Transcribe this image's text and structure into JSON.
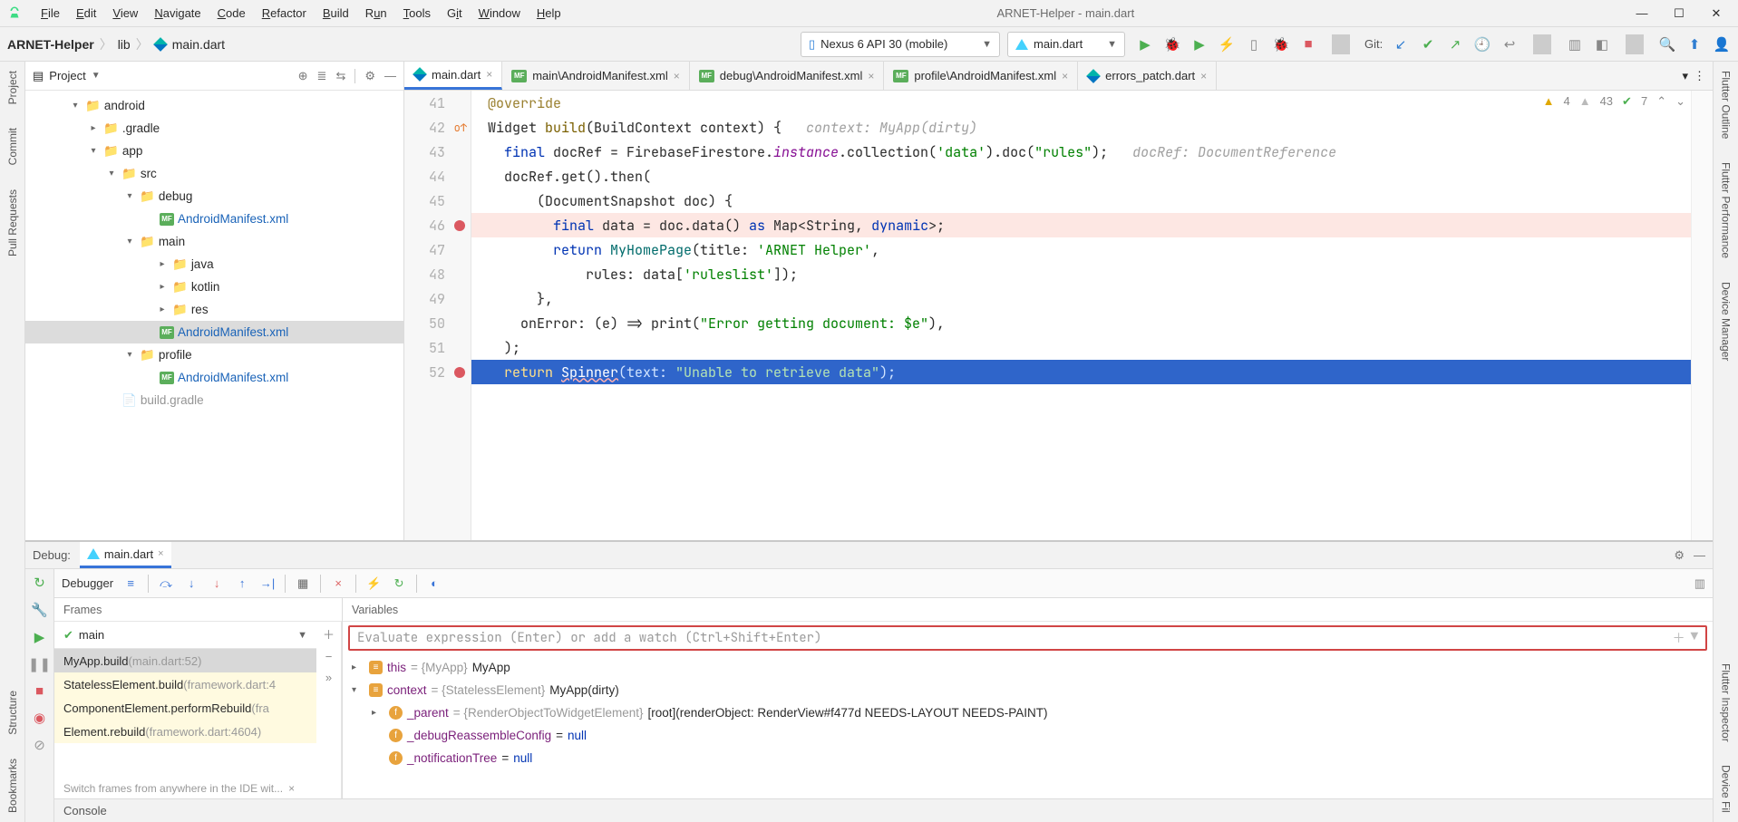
{
  "window_title": "ARNET-Helper - main.dart",
  "menu": [
    "File",
    "Edit",
    "View",
    "Navigate",
    "Code",
    "Refactor",
    "Build",
    "Run",
    "Tools",
    "Git",
    "Window",
    "Help"
  ],
  "breadcrumb": {
    "project": "ARNET-Helper",
    "folder": "lib",
    "file": "main.dart"
  },
  "device_dropdown": "Nexus 6 API 30 (mobile)",
  "config_dropdown": "main.dart",
  "git_label": "Git:",
  "project_panel_title": "Project",
  "tree": {
    "root": "android",
    "gradle": ".gradle",
    "app": "app",
    "src": "src",
    "debug": "debug",
    "debug_manifest": "AndroidManifest.xml",
    "main": "main",
    "java": "java",
    "kotlin": "kotlin",
    "res": "res",
    "main_manifest": "AndroidManifest.xml",
    "profile": "profile",
    "profile_manifest": "AndroidManifest.xml",
    "build_gradle": "build.gradle"
  },
  "tabs": [
    "main.dart",
    "main\\AndroidManifest.xml",
    "debug\\AndroidManifest.xml",
    "profile\\AndroidManifest.xml",
    "errors_patch.dart"
  ],
  "code_annotations": {
    "warn": "4",
    "weak": "43",
    "ok": "7"
  },
  "gutter_lines": [
    "41",
    "42",
    "43",
    "44",
    "45",
    "46",
    "47",
    "48",
    "49",
    "50",
    "51",
    "52"
  ],
  "code_lines": {
    "l41": "@override",
    "l42_pre": "Widget ",
    "l42_fn": "build",
    "l42_paren": "(BuildContext context) {",
    "l42_ctx": "   context: MyApp(dirty)",
    "l43_pre": "  final ",
    "l43_id": "docRef = FirebaseFirestore.",
    "l43_inst": "instance",
    "l43_call": ".collection(",
    "l43_s1": "'data'",
    "l43_mid": ").doc(",
    "l43_s2": "\"rules\"",
    "l43_end": ");",
    "l43_ctx": "   docRef: DocumentReference",
    "l44": "  docRef.get().then(",
    "l45": "      (DocumentSnapshot doc) {",
    "l46_pre": "        final ",
    "l46_mid": "data = doc.data() ",
    "l46_as": "as ",
    "l46_type": "Map<String, ",
    "l46_dyn": "dynamic",
    "l46_end": ">;",
    "l47_pre": "        return ",
    "l47_cls": "MyHomePage",
    "l47_paren": "(title: ",
    "l47_str": "'ARNET Helper'",
    "l47_end": ",",
    "l48_pre": "            rules: data[",
    "l48_str": "'ruleslist'",
    "l48_end": "]);",
    "l49": "      },",
    "l50_pre": "    onError: (e) => print(",
    "l50_str": "\"Error getting document: $e\"",
    "l50_end": "),",
    "l51": "  );",
    "l52_pre": "  return ",
    "l52_cls": "Spinner",
    "l52_paren": "(text: ",
    "l52_str": "\"Unable to retrieve data\"",
    "l52_end": ");"
  },
  "debug": {
    "title": "Debug:",
    "tab": "main.dart",
    "debugger": "Debugger",
    "frames": "Frames",
    "variables": "Variables",
    "thread": "main",
    "eval_placeholder": "Evaluate expression (Enter) or add a watch (Ctrl+Shift+Enter)",
    "stack": [
      {
        "name": "MyApp.build",
        "loc": " (main.dart:52)"
      },
      {
        "name": "StatelessElement.build",
        "loc": " (framework.dart:4"
      },
      {
        "name": "ComponentElement.performRebuild",
        "loc": " (fra"
      },
      {
        "name": "Element.rebuild",
        "loc": " (framework.dart:4604)"
      }
    ],
    "hint": "Switch frames from anywhere in the IDE wit...",
    "console": "Console",
    "vars": {
      "this_key": "this",
      "this_val": " = {MyApp} ",
      "this_tail": "MyApp",
      "ctx_key": "context",
      "ctx_val": " = {StatelessElement} ",
      "ctx_tail": "MyApp(dirty)",
      "parent_key": "_parent",
      "parent_val": " = {RenderObjectToWidgetElement} ",
      "parent_tail": "[root](renderObject: RenderView#f477d NEEDS-LAYOUT NEEDS-PAINT)",
      "dbg_key": "_debugReassembleConfig",
      "dbg_val": " = ",
      "dbg_null": "null",
      "notif_key": "_notificationTree",
      "notif_val": " = ",
      "notif_null": "null"
    }
  },
  "left_labels": [
    "Project",
    "Commit",
    "Pull Requests",
    "Structure",
    "Bookmarks"
  ],
  "right_labels": [
    "Flutter Outline",
    "Flutter Performance",
    "Device Manager",
    "Flutter Inspector",
    "Device Fil"
  ]
}
